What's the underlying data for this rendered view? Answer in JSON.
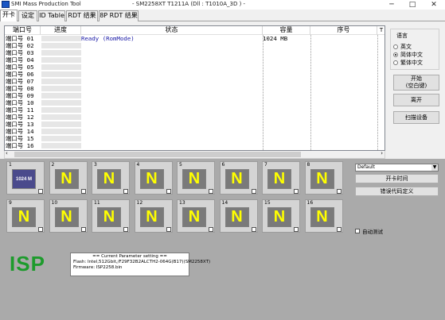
{
  "window": {
    "title": "SMI Mass Production Tool",
    "subtitle": "- SM2258XT   T1211A     (Dll : T1010A_3D ) -",
    "minimize": "─",
    "maximize": "□",
    "close": "✕"
  },
  "tabs": [
    "开卡",
    "设定",
    "ID Table",
    "RDT 结果",
    "8P RDT 结果"
  ],
  "table": {
    "columns": [
      "端口号",
      "进度",
      "状态",
      "容量",
      "序号"
    ],
    "rows": [
      {
        "port": "端口号 01",
        "status": "Ready (RomMode)",
        "capacity": "1024 MB"
      },
      {
        "port": "端口号 02",
        "status": "",
        "capacity": ""
      },
      {
        "port": "端口号 03",
        "status": "",
        "capacity": ""
      },
      {
        "port": "端口号 04",
        "status": "",
        "capacity": ""
      },
      {
        "port": "端口号 05",
        "status": "",
        "capacity": ""
      },
      {
        "port": "端口号 06",
        "status": "",
        "capacity": ""
      },
      {
        "port": "端口号 07",
        "status": "",
        "capacity": ""
      },
      {
        "port": "端口号 08",
        "status": "",
        "capacity": ""
      },
      {
        "port": "端口号 09",
        "status": "",
        "capacity": ""
      },
      {
        "port": "端口号 10",
        "status": "",
        "capacity": ""
      },
      {
        "port": "端口号 11",
        "status": "",
        "capacity": ""
      },
      {
        "port": "端口号 12",
        "status": "",
        "capacity": ""
      },
      {
        "port": "端口号 13",
        "status": "",
        "capacity": ""
      },
      {
        "port": "端口号 14",
        "status": "",
        "capacity": ""
      },
      {
        "port": "端口号 15",
        "status": "",
        "capacity": ""
      },
      {
        "port": "端口号 16",
        "status": "",
        "capacity": ""
      }
    ],
    "extra_col_mark": "T"
  },
  "language": {
    "title": "语言",
    "options": [
      "英文",
      "简体中文",
      "繁体中文"
    ],
    "selected": "简体中文"
  },
  "buttons": {
    "start_line1": "开始",
    "start_line2": "(空白键)",
    "open": "离开",
    "scan": "扫描设备",
    "time_setting": "开卡时间",
    "error_code": "错误代码定义"
  },
  "slots": [
    {
      "num": "1",
      "label": "1024 M",
      "ready": true
    },
    {
      "num": "2",
      "label": "N"
    },
    {
      "num": "3",
      "label": "N"
    },
    {
      "num": "4",
      "label": "N"
    },
    {
      "num": "5",
      "label": "N"
    },
    {
      "num": "6",
      "label": "N"
    },
    {
      "num": "7",
      "label": "N"
    },
    {
      "num": "8",
      "label": "N"
    },
    {
      "num": "9",
      "label": "N"
    },
    {
      "num": "10",
      "label": "N"
    },
    {
      "num": "11",
      "label": "N"
    },
    {
      "num": "12",
      "label": "N"
    },
    {
      "num": "13",
      "label": "N"
    },
    {
      "num": "14",
      "label": "N"
    },
    {
      "num": "15",
      "label": "N"
    },
    {
      "num": "16",
      "label": "N"
    }
  ],
  "combo": {
    "value": "Default",
    "arrow": "▼"
  },
  "autotest": "自动测试",
  "isp": "ISP",
  "param": {
    "title": "== Current Parameter setting ==",
    "flash": "Flash:    Intel,512Gbit,/F29F32B2ALCTH2-064G(B17)(SM2258XT)",
    "firmware": "Firmware:   ISP2258.bin"
  },
  "colors": {
    "isp_green": "#1d9b2c",
    "status_blue": "#1a1aa6",
    "slot_letter": "#ffff00"
  }
}
